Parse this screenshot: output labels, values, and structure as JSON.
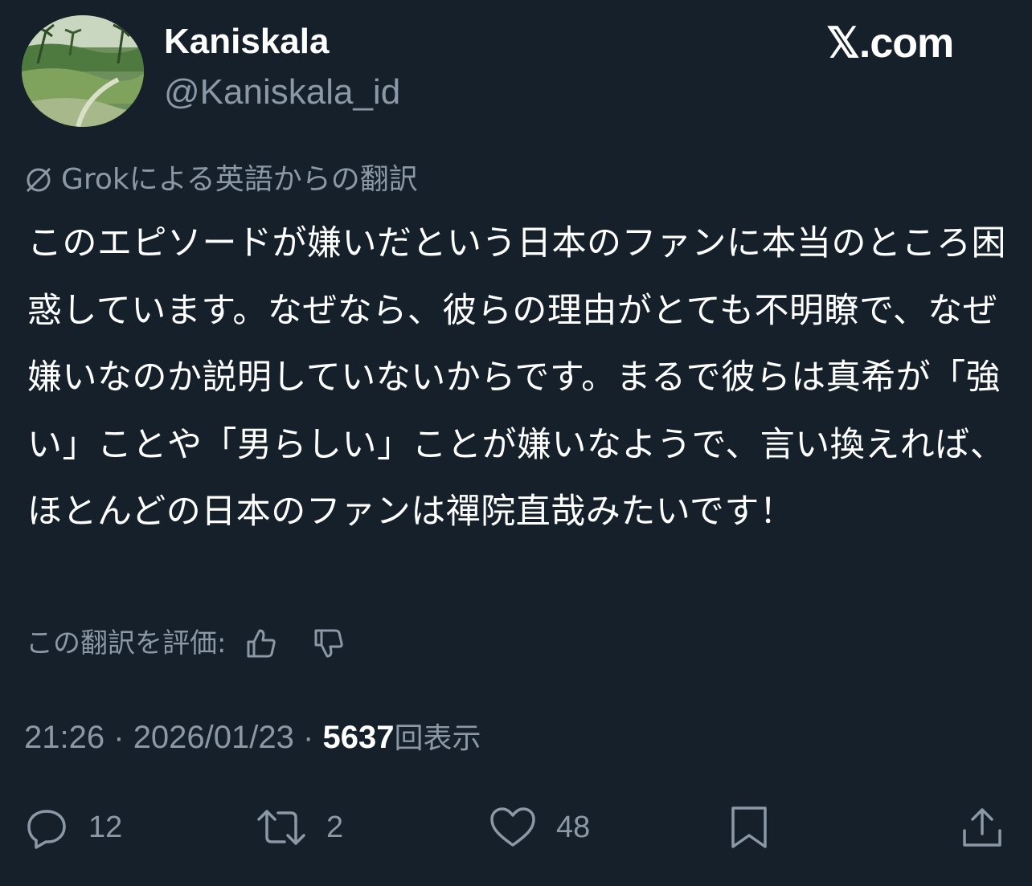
{
  "author": {
    "display_name": "Kaniskala",
    "handle": "@Kaniskala_id"
  },
  "brand": "𝕏.com",
  "translation_note": "Grokによる英語からの翻訳",
  "tweet_text": "このエピソードが嫌いだという日本のファンに本当のところ困惑しています。なぜなら、彼らの理由がとても不明瞭で、なぜ嫌いなのか説明していないからです。まるで彼らは真希が「強い」ことや「男らしい」ことが嫌いなようで、言い換えれば、ほとんどの日本のファンは禪院直哉みたいです！",
  "rate_translation_label": "この翻訳を評価:",
  "meta": {
    "time": "21:26",
    "separator": "·",
    "date": "2026/01/23",
    "views_count": "5637",
    "views_label": "回表示"
  },
  "actions": {
    "replies": "12",
    "reposts": "2",
    "likes": "48"
  },
  "icons": {
    "translation": "grok-icon",
    "rate_up": "thumbs-up-icon",
    "rate_down": "thumbs-down-icon",
    "reply": "reply-icon",
    "repost": "repost-icon",
    "like": "heart-icon",
    "bookmark": "bookmark-icon",
    "share": "share-icon"
  },
  "colors": {
    "background": "#15202b",
    "primary_text": "#ffffff",
    "secondary_text": "#8b98a5"
  }
}
